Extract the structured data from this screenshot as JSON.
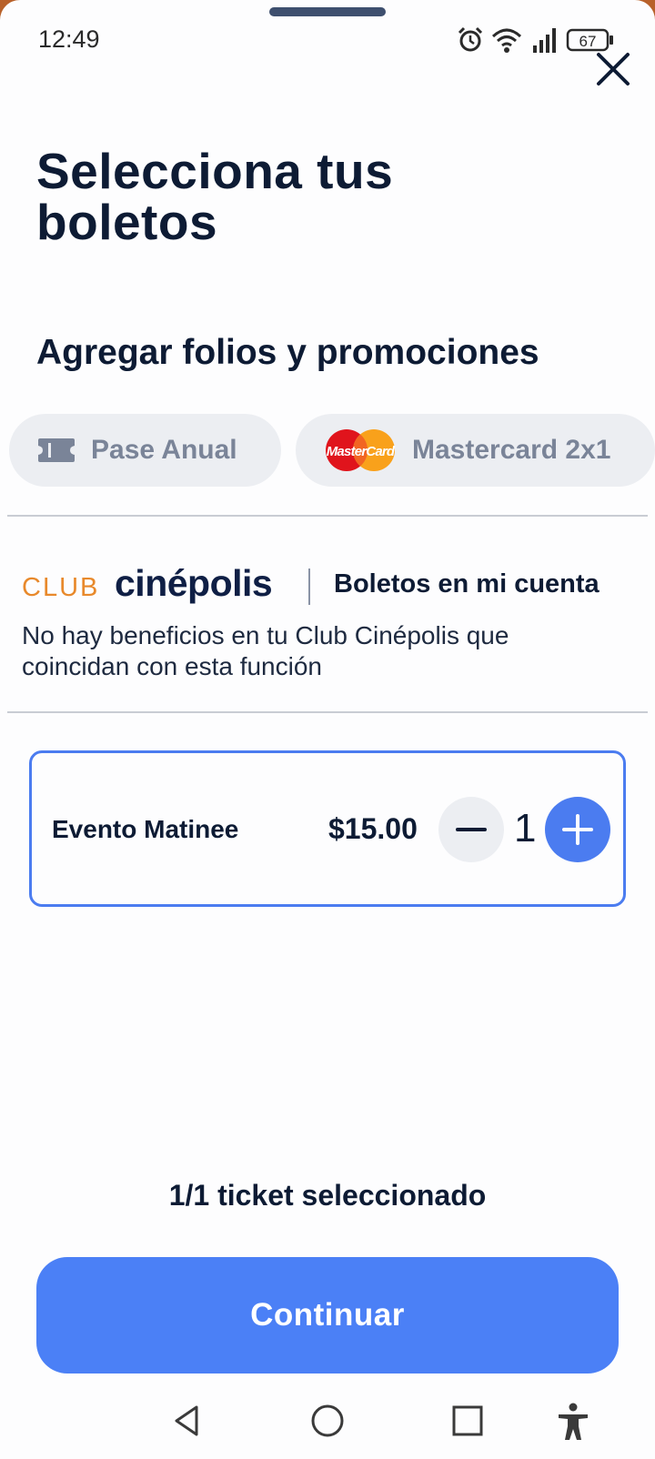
{
  "status_bar": {
    "time": "12:49",
    "battery": "67",
    "icons": [
      "alarm-icon",
      "wifi-icon",
      "signal-icon",
      "battery-icon"
    ]
  },
  "header": {
    "title": "Selecciona tus boletos",
    "close_icon": "close-icon"
  },
  "promotions": {
    "heading": "Agregar folios y promociones",
    "chips": [
      {
        "label": "Pase Anual",
        "icon": "ticket-icon"
      },
      {
        "label": "Mastercard 2x1",
        "icon": "mastercard-logo"
      }
    ]
  },
  "club": {
    "logo_club": "CLUB",
    "logo_cine": "cinépolis",
    "account_label": "Boletos en mi cuenta",
    "message": "No hay beneficios en tu Club Cinépolis que coincidan con esta función"
  },
  "tickets": [
    {
      "name": "Evento Matinee",
      "price": "$15.00",
      "quantity": "1"
    }
  ],
  "summary": "1/1 ticket seleccionado",
  "continue_label": "Continuar",
  "nav": [
    "back-icon",
    "home-icon",
    "recents-icon",
    "accessibility-icon"
  ],
  "colors": {
    "primary": "#4b80f6",
    "text": "#0d1b34",
    "chip_bg": "#eceef2",
    "club_orange": "#e8892b"
  }
}
